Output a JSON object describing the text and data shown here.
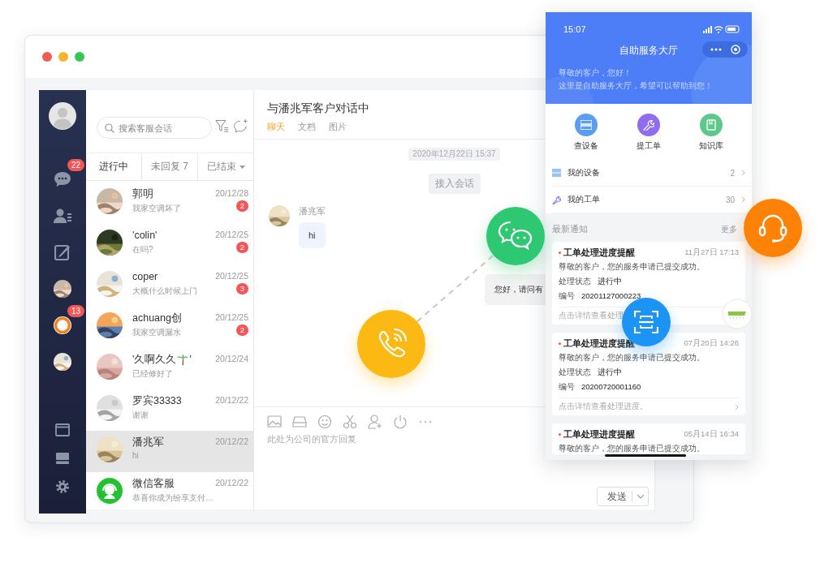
{
  "sidebar": {
    "items": [
      {
        "kind": "chat",
        "badge": "22"
      },
      {
        "kind": "contacts"
      },
      {
        "kind": "edit"
      },
      {
        "kind": "picture"
      },
      {
        "kind": "logo",
        "badge": "13"
      },
      {
        "kind": "picture"
      }
    ],
    "bottom_items": [
      {
        "kind": "window"
      },
      {
        "kind": "monitor"
      },
      {
        "kind": "settings"
      }
    ]
  },
  "conversations": {
    "search": {
      "placeholder": "搜索客服会话"
    },
    "tabs": [
      {
        "label": "进行中",
        "selected": true
      },
      {
        "label": "未回复 7",
        "selected": false
      },
      {
        "label": "已结束",
        "selected": false,
        "dropdown": true
      }
    ],
    "rows": [
      {
        "avatar": {
          "kind": "picture"
        },
        "name": "郭明",
        "preview": "我家空调坏了",
        "date": "20/12/28",
        "unread": "2",
        "selected": false
      },
      {
        "avatar": {
          "kind": "picture"
        },
        "name": "'colin'",
        "preview": "在吗?",
        "date": "20/12/25",
        "unread": "2",
        "selected": false
      },
      {
        "avatar": {
          "kind": "picture"
        },
        "name": "coper",
        "preview": "大概什么时候上门",
        "date": "20/12/25",
        "unread": "3",
        "selected": false
      },
      {
        "avatar": {
          "kind": "picture"
        },
        "name": "achuang创",
        "preview": "我家空调漏水",
        "date": "20/12/25",
        "unread": "2",
        "selected": false
      },
      {
        "avatar": {
          "kind": "picture"
        },
        "name": "'久啊久久",
        "name_icon": {
          "kind": "palm"
        },
        "name_end": "'",
        "preview": "已经修好了",
        "date": "20/12/24",
        "selected": false
      },
      {
        "avatar": {
          "kind": "picture"
        },
        "name": "罗宾33333",
        "preview": "谢谢",
        "date": "20/12/22",
        "selected": false
      },
      {
        "avatar": {
          "kind": "picture"
        },
        "name": "潘兆军",
        "preview": "hi",
        "date": "20/12/22",
        "selected": true
      },
      {
        "avatar": {
          "kind": "service"
        },
        "name": "微信客服",
        "preview": "恭喜你成为纷享支付…",
        "date": "20/12/22",
        "selected": false
      }
    ]
  },
  "chat": {
    "title": "与潘兆军客户对话中",
    "tabs": [
      {
        "label": "聊天",
        "selected": true
      },
      {
        "label": "文档",
        "selected": false
      },
      {
        "label": "图片",
        "selected": false
      }
    ],
    "timestamp": "2020年12月22日 15:37",
    "join_button": "接入会话",
    "messages": [
      {
        "kind": "incoming",
        "sender": "潘兆军",
        "text": "hi"
      },
      {
        "kind": "outgoing",
        "text": "您好，请问有"
      }
    ],
    "reply": {
      "placeholder": "此处为公司的官方回复"
    },
    "send_button": "发送"
  },
  "phone": {
    "time": "15:07",
    "title": "自助服务大厅",
    "greeting": [
      "尊敬的客户，您好！",
      "这里是自助服务大厅，希望可以帮助到您！"
    ],
    "actions": [
      {
        "kind": "devices",
        "label": "查设备",
        "color": "#5c9df2"
      },
      {
        "kind": "wrench",
        "label": "提工单",
        "color": "#8f6cf0"
      },
      {
        "kind": "book",
        "label": "知识库",
        "color": "#5cc98a"
      }
    ],
    "links": [
      {
        "kind": "devices",
        "label": "我的设备",
        "count": "2"
      },
      {
        "kind": "wrench",
        "label": "我的工单",
        "count": "30"
      }
    ],
    "notices": {
      "title": "最新通知",
      "more": "更多",
      "items": [
        {
          "title": "工单处理进度提醒",
          "time": "11月27日 17:13",
          "body": "尊敬的客户，您的服务申请已提交成功。",
          "status_label": "处理状态",
          "status": "进行中",
          "number_label": "编号",
          "number": "20201127000223",
          "footer": "点击详情查看处理"
        },
        {
          "title": "工单处理进度提醒",
          "time": "07月20日 14:26",
          "body": "尊敬的客户，您的服务申请已提交成功。",
          "status_label": "处理状态",
          "status": "进行中",
          "number_label": "编号",
          "number": "20200720001160",
          "footer": "点击详情查看处理进度。"
        },
        {
          "title": "工单处理进度提醒",
          "time": "05月14日 16:34",
          "body": "尊敬的客户，您的服务申请已提交成功。"
        }
      ]
    }
  }
}
